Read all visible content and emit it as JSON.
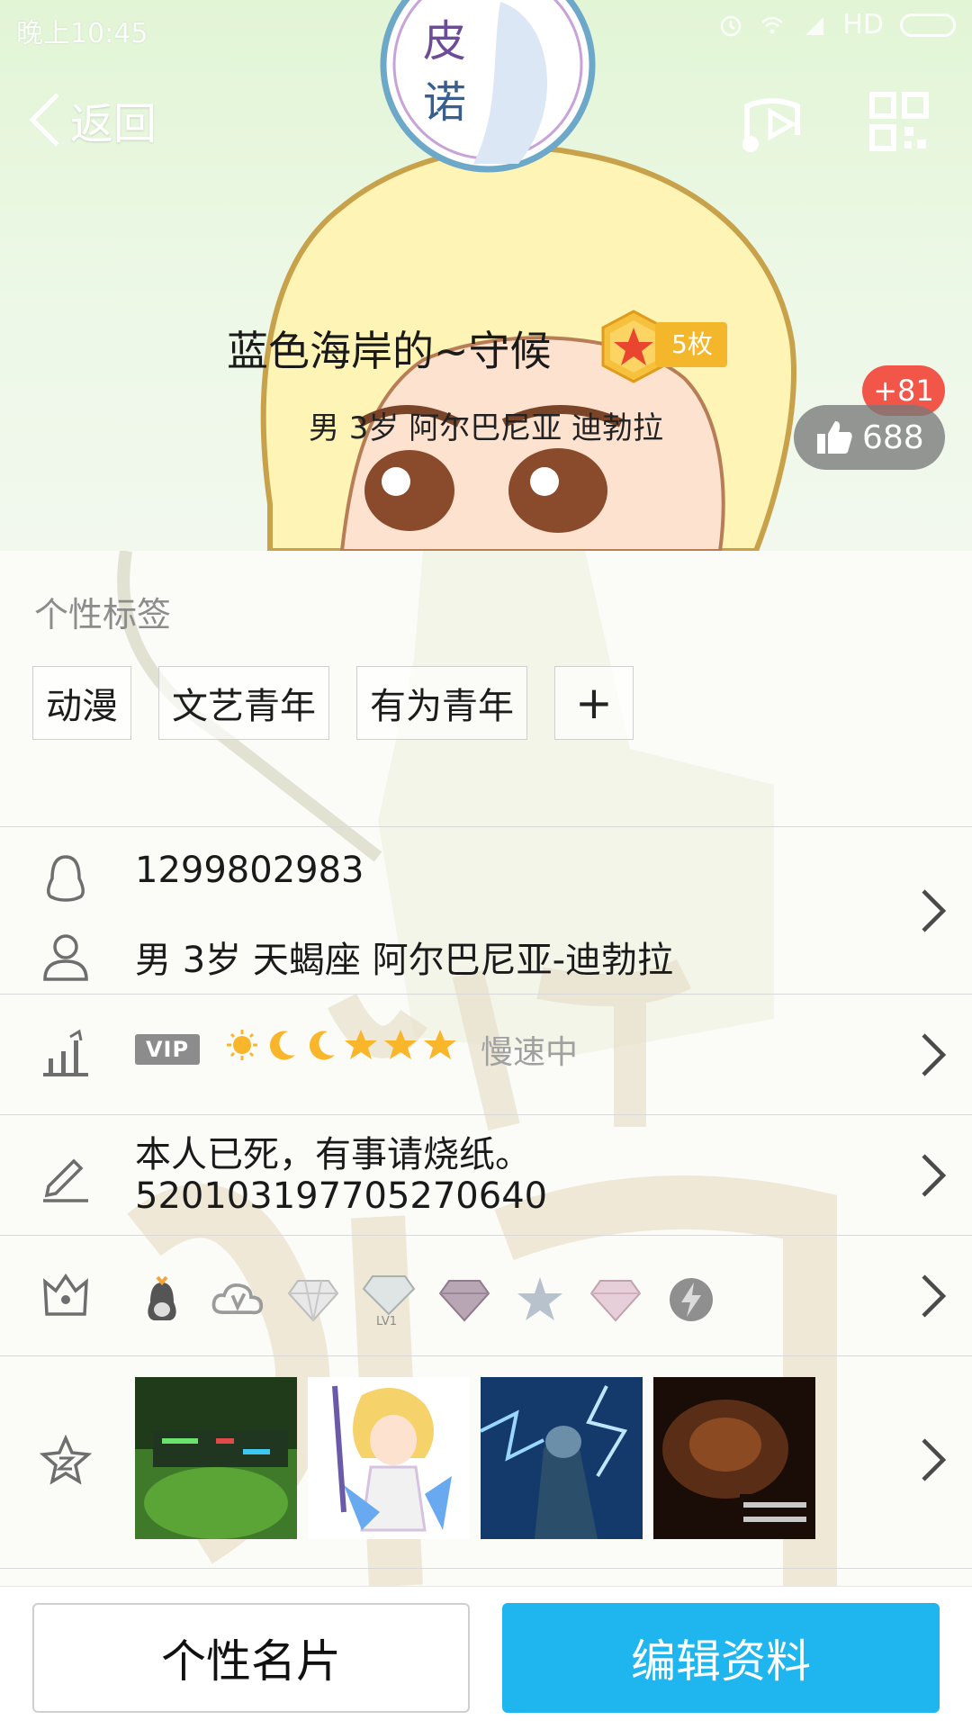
{
  "status_bar": {
    "time": "晚上10:45",
    "network": "HD"
  },
  "nav": {
    "back_label": "返回"
  },
  "avatar": {
    "text_line1": "皮",
    "text_line2": "诺"
  },
  "profile": {
    "nickname": "蓝色海岸的~守候",
    "medal_count": "5枚",
    "subinfo": "男 3岁 阿尔巴尼亚 迪勃拉",
    "likes": "688",
    "likes_new": "+81"
  },
  "tags_section": {
    "title": "个性标签",
    "tags": [
      "动漫",
      "文艺青年",
      "有为青年"
    ],
    "add_label": "+"
  },
  "info": {
    "qq_number": "1299802983",
    "details": "男  3岁  天蝎座  阿尔巴尼亚-迪勃拉",
    "vip_label": "VIP",
    "speed_status": "慢速中",
    "signature_line1": "本人已死，有事请烧纸。",
    "signature_line2": "520103197705270640",
    "level_icons": [
      "sun-icon",
      "moon-icon",
      "moon-icon",
      "star-icon",
      "star-icon",
      "star-icon"
    ],
    "badge_icons": [
      "penguin-badge-icon",
      "cloud-v-badge-icon",
      "diamond-badge-icon",
      "diamond-lv1-badge-icon",
      "diamond-purple-badge-icon",
      "star-badge-icon",
      "diamond-pink-badge-icon",
      "lightning-badge-icon"
    ],
    "badge_lv1_label": "LV1"
  },
  "colors": {
    "accent": "#1fb6f0",
    "medal": "#f4b62b",
    "like_badge": "#f25648"
  },
  "bottom": {
    "card_button": "个性名片",
    "edit_button": "编辑资料"
  }
}
